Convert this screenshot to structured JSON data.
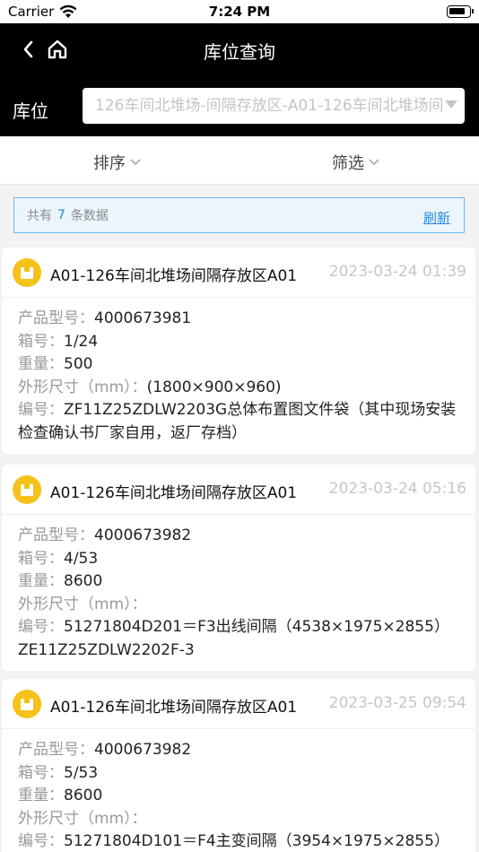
{
  "status": {
    "carrier": "Carrier",
    "time": "7:24 PM"
  },
  "header": {
    "title": "库位查询",
    "location_label": "库位",
    "location_value": "126车间北堆场-间隔存放区-A01-126车间北堆场间"
  },
  "toolbar": {
    "sort_label": "排序",
    "filter_label": "筛选"
  },
  "summary": {
    "prefix": "共有",
    "count": "7",
    "suffix": "条数据",
    "refresh_label": "刷新"
  },
  "labels": {
    "model": "产品型号：",
    "box": "箱号：",
    "weight": "重量：",
    "size": "外形尺寸（mm）：",
    "code": "编号："
  },
  "cards": [
    {
      "title": "A01-126车间北堆场间隔存放区A01",
      "time": "2023-03-24 01:39",
      "model": "4000673981",
      "box": "1/24",
      "weight": "500",
      "size": "(1800×900×960)",
      "code": "ZF11Z25ZDLW2203G总体布置图文件袋（其中现场安装检查确认书厂家自用，返厂存档）"
    },
    {
      "title": "A01-126车间北堆场间隔存放区A01",
      "time": "2023-03-24 05:16",
      "model": "4000673982",
      "box": "4/53",
      "weight": "8600",
      "size": "",
      "code": "51271804D201＝F3出线间隔（4538×1975×2855）ZE11Z25ZDLW2202F-3"
    },
    {
      "title": "A01-126车间北堆场间隔存放区A01",
      "time": "2023-03-25 09:54",
      "model": "4000673982",
      "box": "5/53",
      "weight": "8600",
      "size": "",
      "code": "51271804D101＝F4主变间隔（3954×1975×2855）"
    }
  ]
}
